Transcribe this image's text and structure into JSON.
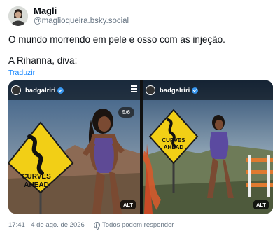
{
  "post": {
    "display_name": "Magli",
    "handle": "@maglioqueira.bsky.social",
    "text_line1": "O mundo morrendo em pele e osso com as injeção.",
    "text_line2": "A Rihanna, diva:",
    "translate_label": "Traduzir",
    "footer_time": "17:41 · 4 de ago. de 2026",
    "footer_separator": "·",
    "footer_reply": "Todos podem responder"
  },
  "media": {
    "left": {
      "username": "badgalriri",
      "counter": "5/6",
      "sign_line1": "CURVES",
      "sign_line2": "AHEAD",
      "alt_label": "ALT"
    },
    "right": {
      "username": "badgalriri",
      "sign_line1": "CURVES",
      "sign_line2": "AHEAD",
      "alt_label": "ALT"
    }
  },
  "icons": [
    "avatar-image",
    "verified-icon",
    "menu-icon",
    "globe-icon"
  ]
}
